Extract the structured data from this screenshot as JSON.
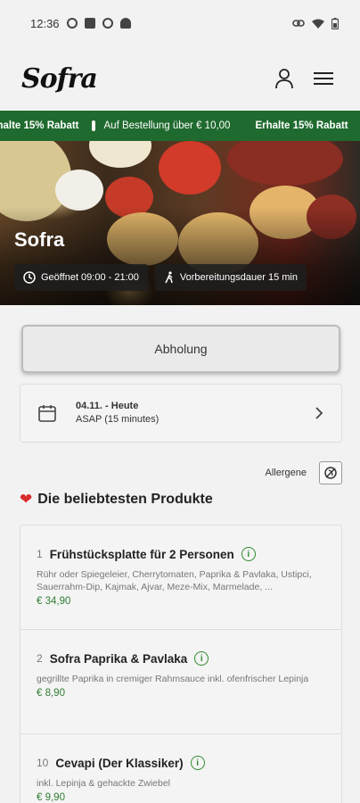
{
  "status_bar": {
    "time": "12:36"
  },
  "header": {
    "logo_text": "Sofra"
  },
  "ticker": {
    "items": [
      "rhalte 15% Rabatt",
      "Auf Bestellung über € 10,00",
      "Erhalte 15% Rabatt"
    ]
  },
  "hero": {
    "title": "Sofra",
    "open_hours": "Geöffnet 09:00 - 21:00",
    "prep_time": "Vorbereitungsdauer 15 min"
  },
  "order_mode": {
    "label": "Abholung"
  },
  "date_selector": {
    "date": "04.11. - Heute",
    "time": "ASAP (15 minutes)"
  },
  "allergens": {
    "label": "Allergene"
  },
  "popular": {
    "title": "Die beliebtesten Produkte",
    "products": [
      {
        "number": "1",
        "name": "Frühstücksplatte für 2 Personen",
        "description": "Rühr oder Spiegeleier, Cherrytomaten, Paprika & Pavlaka, Ustipci, Sauerrahm-Dip, Kajmak, Ajvar, Meze-Mix, Marmelade, ...",
        "price": "€ 34,90"
      },
      {
        "number": "2",
        "name": "Sofra Paprika & Pavlaka",
        "description": "gegrillte Paprika in cremiger Rahmsauce inkl. ofenfrischer Lepinja",
        "price": "€ 8,90"
      },
      {
        "number": "10",
        "name": "Cevapi (Der Klassiker)",
        "description": "inkl. Lepinja & gehackte Zwiebel",
        "price": "€ 9,90"
      }
    ]
  },
  "colors": {
    "brand_green": "#1f6a2e",
    "price_green": "#2e7d32",
    "heart_red": "#d92b2b"
  }
}
